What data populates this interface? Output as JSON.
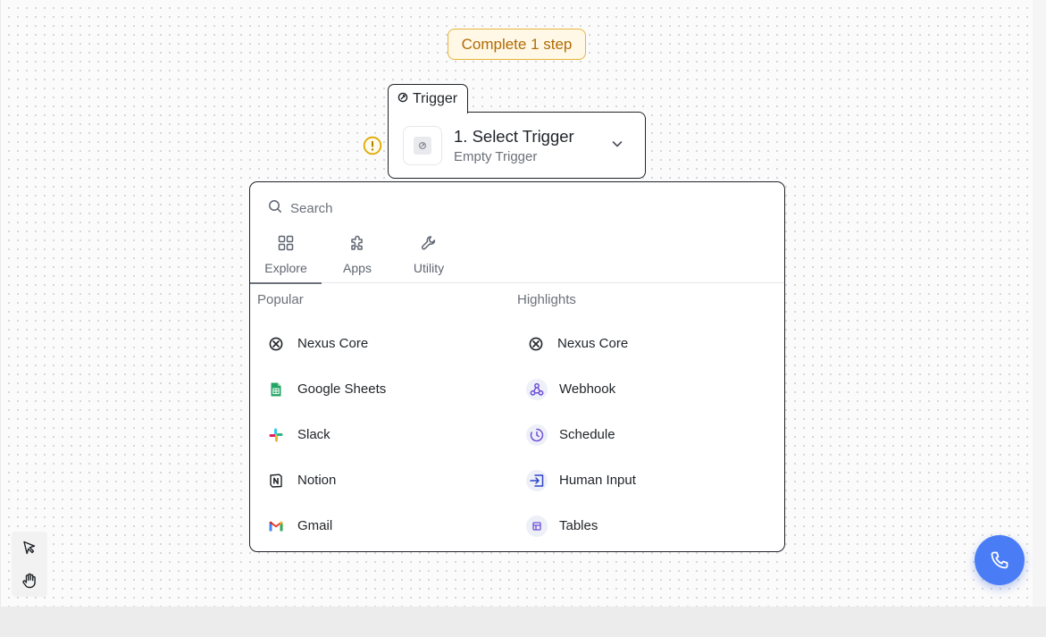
{
  "badge": {
    "label": "Complete 1 step"
  },
  "trigger": {
    "tab_label": "Trigger",
    "title": "1. Select Trigger",
    "subtitle": "Empty Trigger"
  },
  "search": {
    "placeholder": "Search"
  },
  "tabs": [
    {
      "label": "Explore",
      "icon": "grid-icon",
      "active": true
    },
    {
      "label": "Apps",
      "icon": "puzzle-icon",
      "active": false
    },
    {
      "label": "Utility",
      "icon": "wrench-icon",
      "active": false
    }
  ],
  "popular": {
    "heading": "Popular",
    "items": [
      {
        "label": "Nexus Core",
        "icon": "nexus-core-icon"
      },
      {
        "label": "Google Sheets",
        "icon": "google-sheets-icon"
      },
      {
        "label": "Slack",
        "icon": "slack-icon"
      },
      {
        "label": "Notion",
        "icon": "notion-icon"
      },
      {
        "label": "Gmail",
        "icon": "gmail-icon"
      }
    ]
  },
  "highlights": {
    "heading": "Highlights",
    "items": [
      {
        "label": "Nexus Core",
        "icon": "nexus-core-icon"
      },
      {
        "label": "Webhook",
        "icon": "webhook-icon"
      },
      {
        "label": "Schedule",
        "icon": "schedule-icon"
      },
      {
        "label": "Human Input",
        "icon": "human-input-icon"
      },
      {
        "label": "Tables",
        "icon": "tables-icon"
      }
    ]
  },
  "colors": {
    "badge_border": "#e7b43c",
    "badge_text": "#b06b05",
    "warning": "#e0a800",
    "fab": "#4a7df5",
    "accent_purple": "#6d4ed6"
  }
}
